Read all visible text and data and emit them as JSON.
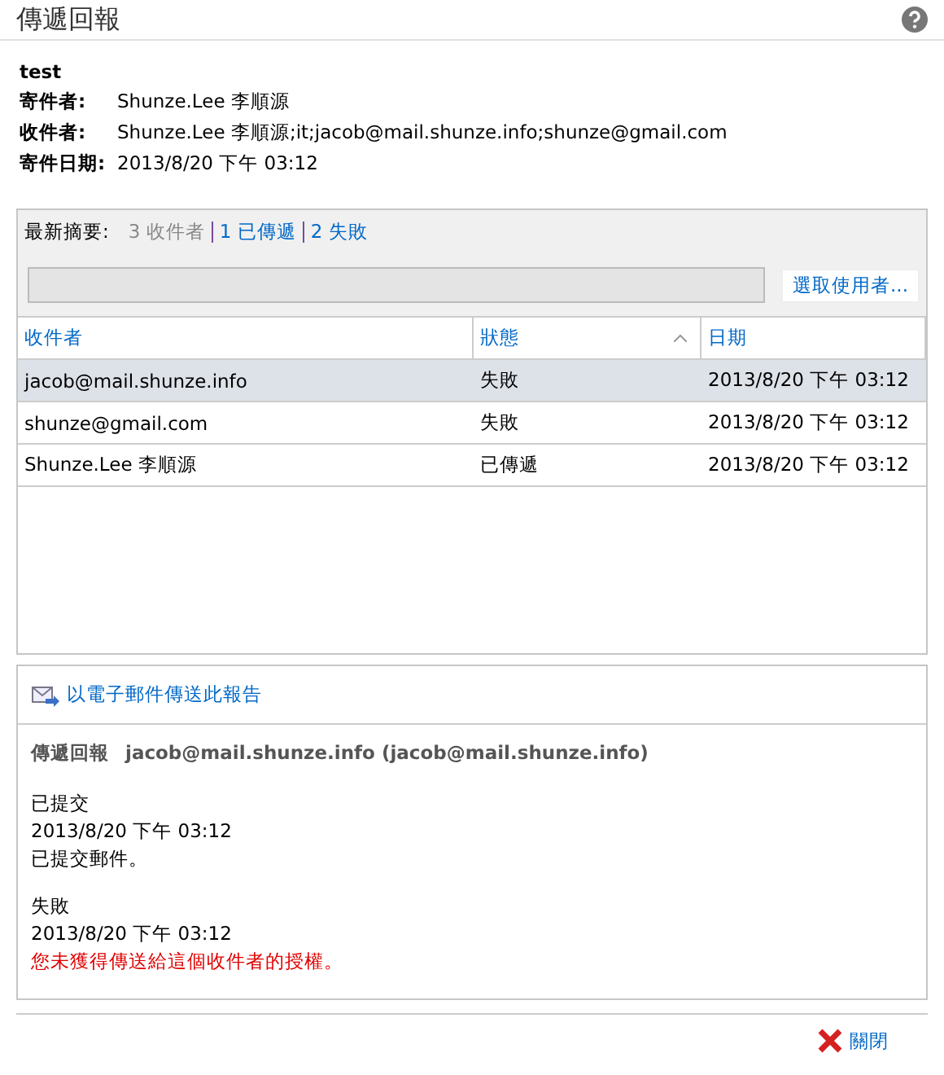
{
  "window": {
    "title": "傳遞回報"
  },
  "message": {
    "subject": "test",
    "fields": [
      {
        "label": "寄件者:",
        "value": "Shunze.Lee 李順源"
      },
      {
        "label": "收件者:",
        "value": "Shunze.Lee 李順源;it;jacob@mail.shunze.info;shunze@gmail.com"
      },
      {
        "label": "寄件日期:",
        "value": "2013/8/20 下午 03:12"
      }
    ]
  },
  "summary": {
    "label": "最新摘要:",
    "total": "3 收件者",
    "links": [
      "1 已傳遞",
      "2 失敗"
    ]
  },
  "search": {
    "button": "選取使用者..."
  },
  "table": {
    "columns": [
      {
        "label": "收件者",
        "sorted": false
      },
      {
        "label": "狀態",
        "sorted": true
      },
      {
        "label": "日期",
        "sorted": false
      }
    ],
    "rows": [
      {
        "cells": [
          "jacob@mail.shunze.info",
          "失敗",
          "2013/8/20 下午 03:12"
        ],
        "selected": true
      },
      {
        "cells": [
          "shunze@gmail.com",
          "失敗",
          "2013/8/20 下午 03:12"
        ],
        "selected": false
      },
      {
        "cells": [
          "Shunze.Lee 李順源",
          "已傳遞",
          "2013/8/20 下午 03:12"
        ],
        "selected": false
      }
    ]
  },
  "report": {
    "email_link": "以電子郵件傳送此報告",
    "heading": "傳遞回報",
    "recipient": "jacob@mail.shunze.info (jacob@mail.shunze.info)",
    "events": [
      {
        "status": "已提交",
        "date": "2013/8/20 下午 03:12",
        "message": "已提交郵件。",
        "kind": "normal"
      },
      {
        "status": "失敗",
        "date": "2013/8/20 下午 03:12",
        "message": "您未獲得傳送給這個收件者的授權。",
        "kind": "error"
      }
    ]
  },
  "footer": {
    "close": "關閉"
  }
}
